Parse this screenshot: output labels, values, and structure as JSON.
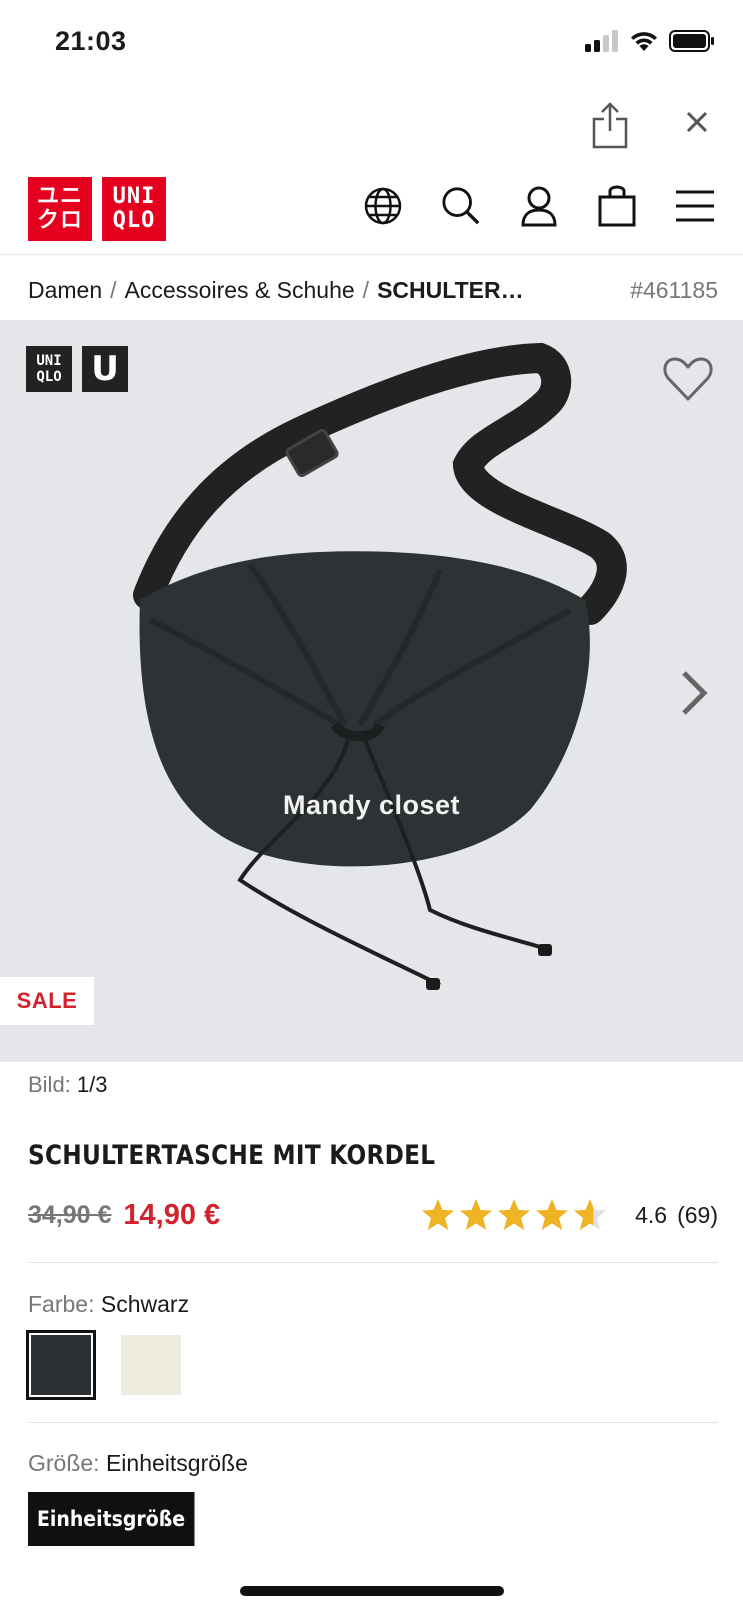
{
  "status_bar": {
    "time": "21:03"
  },
  "brand": {
    "logo_katakana": [
      "ユニ",
      "クロ"
    ],
    "logo_latin": [
      "UNI",
      "QLO"
    ],
    "accent_color": "#e4001e"
  },
  "header": {
    "icons": [
      "globe-icon",
      "search-icon",
      "account-icon",
      "shopping-bag-icon",
      "menu-icon"
    ]
  },
  "breadcrumb": {
    "items": [
      "Damen",
      "Accessoires & Schuhe"
    ],
    "current": "SCHULTER…",
    "product_code": "#461185"
  },
  "gallery": {
    "brand_tag_lines": [
      "UNI",
      "QLO"
    ],
    "brand_tag_u": "U",
    "watermark": "Mandy closet",
    "sale_badge": "SALE",
    "counter_label": "Bild:",
    "counter_value": "1/3"
  },
  "product": {
    "title": "SCHULTERTASCHE MIT KORDEL",
    "old_price": "34,90 €",
    "new_price": "14,90 €",
    "sale_color": "#d2222d",
    "rating_value": 4.6,
    "rating_text": "4.6",
    "review_count": "(69)",
    "star_color": "#f0b323"
  },
  "color_selector": {
    "label": "Farbe:",
    "value": "Schwarz",
    "swatches": [
      {
        "color": "#2b3133",
        "selected": true
      },
      {
        "color": "#efebdf",
        "selected": false
      }
    ]
  },
  "size_selector": {
    "label": "Größe:",
    "value": "Einheitsgröße",
    "chip": "Einheitsgröße"
  }
}
